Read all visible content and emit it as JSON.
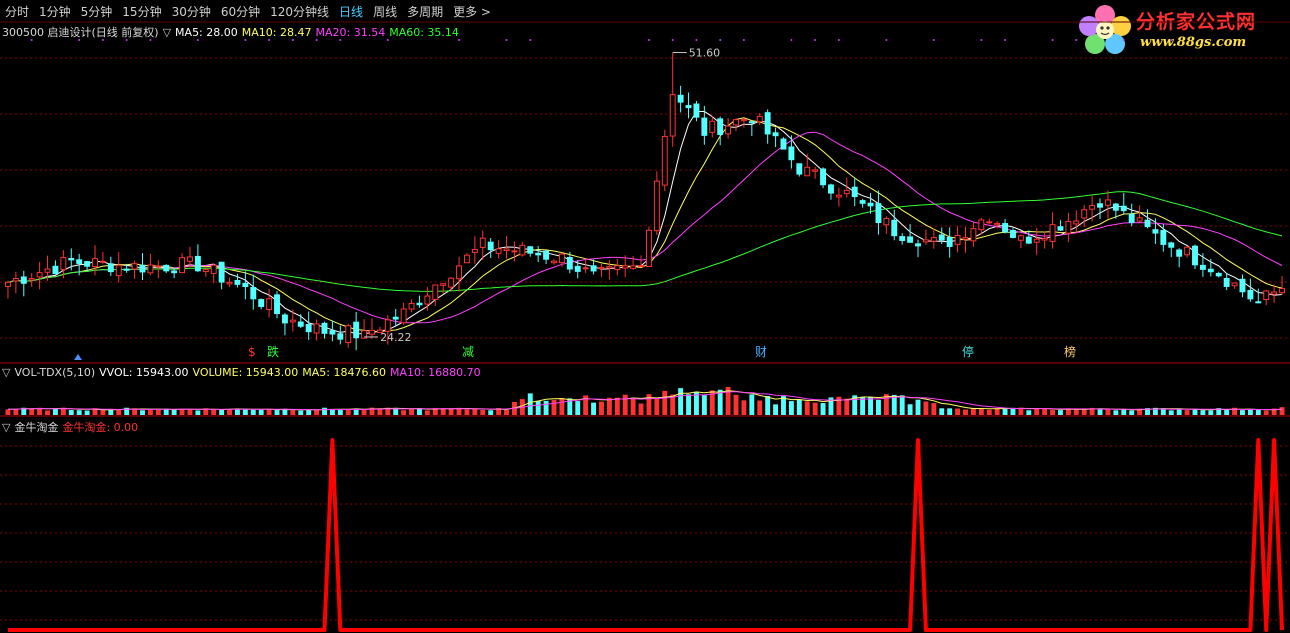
{
  "toolbar": {
    "tabs": [
      {
        "label": "分时",
        "active": false
      },
      {
        "label": "1分钟",
        "active": false
      },
      {
        "label": "5分钟",
        "active": false
      },
      {
        "label": "15分钟",
        "active": false
      },
      {
        "label": "30分钟",
        "active": false
      },
      {
        "label": "60分钟",
        "active": false
      },
      {
        "label": "120分钟线",
        "active": false
      },
      {
        "label": "日线",
        "active": true
      },
      {
        "label": "周线",
        "active": false
      },
      {
        "label": "多周期",
        "active": false
      },
      {
        "label": "更多 >",
        "active": false
      }
    ]
  },
  "watermark": {
    "title": "分析家公式网",
    "url": "www.88gs.com"
  },
  "main_panel": {
    "header": "300500 启迪设计(日线 前复权)",
    "indicator_marker": "▽",
    "ma5": "MA5: 28.00",
    "ma10": "MA10: 28.47",
    "ma20": "MA20: 31.54",
    "ma60": "MA60: 35.14",
    "high_label": "51.60",
    "low_label": "24.22"
  },
  "event_tags": [
    {
      "text": "$",
      "color": "#ff3030"
    },
    {
      "text": "跌",
      "color": "#30ff30"
    },
    {
      "text": "减",
      "color": "#30ff30"
    },
    {
      "text": "财",
      "color": "#4ab0ff"
    },
    {
      "text": "停",
      "color": "#40e0e0"
    },
    {
      "text": "榜",
      "color": "#ffcc66"
    }
  ],
  "volume_panel": {
    "header": "VOL-TDX(5,10)",
    "vvol": "VVOL: 15943.00",
    "volume": "VOLUME: 15943.00",
    "ma5": "MA5: 18476.60",
    "ma10": "MA10: 16880.70"
  },
  "signal_panel": {
    "header": "金牛淘金",
    "value": "金牛淘金: 0.00"
  },
  "colors": {
    "up": "#ff3232",
    "down": "#54ffff",
    "ma5": "#ffffff",
    "ma10": "#ffff60",
    "ma20": "#ff40ff",
    "ma60": "#30ff30",
    "signal": "#ff0000",
    "grid": "#8b0000"
  },
  "chart_data": [
    {
      "type": "candlestick",
      "title": "300500 启迪设计(日线 前复权)",
      "ylim": [
        22,
        53
      ],
      "anchors": [
        [
          0,
          29.5
        ],
        [
          8,
          31.5
        ],
        [
          16,
          31.0
        ],
        [
          24,
          31.2
        ],
        [
          30,
          28.8
        ],
        [
          35,
          26.0
        ],
        [
          40,
          24.8
        ],
        [
          45,
          24.5
        ],
        [
          50,
          26.5
        ],
        [
          55,
          30.0
        ],
        [
          60,
          33.0
        ],
        [
          65,
          32.5
        ],
        [
          70,
          31.8
        ],
        [
          74,
          30.0
        ],
        [
          80,
          31.0
        ],
        [
          84,
          48.0
        ],
        [
          88,
          44.0
        ],
        [
          94,
          45.5
        ],
        [
          100,
          40.5
        ],
        [
          106,
          38.0
        ],
        [
          112,
          34.5
        ],
        [
          118,
          33.0
        ],
        [
          124,
          36.0
        ],
        [
          128,
          33.5
        ],
        [
          134,
          35.5
        ],
        [
          138,
          37.5
        ],
        [
          142,
          35.5
        ],
        [
          146,
          33.5
        ],
        [
          152,
          31.0
        ],
        [
          158,
          27.5
        ],
        [
          161,
          29.0
        ]
      ],
      "high_marker": {
        "index": 84,
        "value": 51.6
      },
      "low_marker": {
        "index": 45,
        "value": 24.22
      },
      "series": [
        {
          "name": "MA5",
          "value": 28.0
        },
        {
          "name": "MA10",
          "value": 28.47
        },
        {
          "name": "MA20",
          "value": 31.54
        },
        {
          "name": "MA60",
          "value": 35.14
        }
      ]
    },
    {
      "type": "bar",
      "title": "VOL-TDX(5,10)",
      "ylim": [
        0,
        75000
      ],
      "series": [
        {
          "name": "VOLUME",
          "value": 15943.0
        },
        {
          "name": "MA5",
          "value": 18476.6
        },
        {
          "name": "MA10",
          "value": 16880.7
        }
      ]
    },
    {
      "type": "line",
      "title": "金牛淘金",
      "ylim": [
        0,
        1
      ],
      "spike_indices": [
        41,
        115,
        158,
        160
      ],
      "series": [
        {
          "name": "金牛淘金",
          "last_value": 0.0
        }
      ]
    }
  ]
}
